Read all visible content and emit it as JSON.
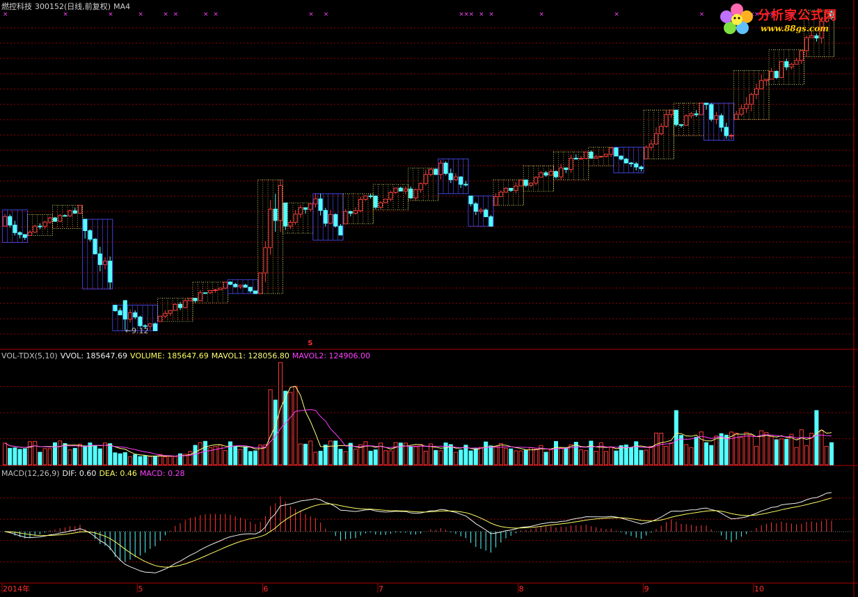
{
  "header": {
    "name": "燃控科技",
    "code": "300152",
    "period": "(日线,前复权)",
    "indicator": "MA4"
  },
  "logo": {
    "name": "分析家公式网",
    "url": "www.88gs.com"
  },
  "vol_header": {
    "title": "VOL-TDX(5,10)",
    "vvol": "VVOL: 185647.69",
    "volume": "VOLUME: 185647.69",
    "mavol1": "MAVOL1: 128056.80",
    "mavol2": "MAVOL2: 124906.00"
  },
  "macd_header": {
    "title": "MACD(12,26,9)",
    "dif": "DIF: 0.60",
    "dea": "DEA: 0.46",
    "macd": "MACD: 0.28"
  },
  "low_label": "9.12",
  "s_mark": "S",
  "x_labels": [
    {
      "text": "2014年",
      "index": 0
    },
    {
      "text": "5",
      "index": 27
    },
    {
      "text": "6",
      "index": 52
    },
    {
      "text": "7",
      "index": 75
    },
    {
      "text": "8",
      "index": 103
    },
    {
      "text": "9",
      "index": 128
    },
    {
      "text": "10",
      "index": 150
    }
  ],
  "colors": {
    "up": "#ff3a3a",
    "down": "#54ffff",
    "ma5": "#ffff80",
    "ma10": "#ff40ff",
    "dif": "#f0f0f0",
    "dea": "#ffff60",
    "grid": "#990000",
    "border": "#b00000",
    "box_up": "#ffff80",
    "box_down": "#5050ff",
    "marker": "#ff40ff"
  },
  "chart_data": {
    "type": "candlestick",
    "price_range": [
      9.0,
      20.0
    ],
    "boxes": [
      {
        "start": 0,
        "end": 4,
        "low": 12.9,
        "high": 14.3,
        "dir": "down"
      },
      {
        "start": 5,
        "end": 9,
        "low": 13.2,
        "high": 14.1,
        "dir": "up"
      },
      {
        "start": 10,
        "end": 15,
        "low": 13.5,
        "high": 14.5,
        "dir": "up"
      },
      {
        "start": 16,
        "end": 21,
        "low": 10.9,
        "high": 13.9,
        "dir": "down"
      },
      {
        "start": 22,
        "end": 30,
        "low": 9.1,
        "high": 10.2,
        "dir": "down"
      },
      {
        "start": 31,
        "end": 37,
        "low": 9.5,
        "high": 10.5,
        "dir": "up"
      },
      {
        "start": 38,
        "end": 44,
        "low": 10.3,
        "high": 11.2,
        "dir": "up"
      },
      {
        "start": 45,
        "end": 50,
        "low": 10.7,
        "high": 11.3,
        "dir": "down"
      },
      {
        "start": 51,
        "end": 55,
        "low": 10.7,
        "high": 15.6,
        "dir": "up"
      },
      {
        "start": 56,
        "end": 61,
        "low": 13.3,
        "high": 14.6,
        "dir": "up"
      },
      {
        "start": 62,
        "end": 67,
        "low": 13.0,
        "high": 15.0,
        "dir": "down"
      },
      {
        "start": 68,
        "end": 73,
        "low": 13.7,
        "high": 15.0,
        "dir": "up"
      },
      {
        "start": 74,
        "end": 80,
        "low": 14.3,
        "high": 15.4,
        "dir": "up"
      },
      {
        "start": 81,
        "end": 86,
        "low": 14.7,
        "high": 16.1,
        "dir": "up"
      },
      {
        "start": 87,
        "end": 92,
        "low": 15.0,
        "high": 16.5,
        "dir": "down"
      },
      {
        "start": 93,
        "end": 97,
        "low": 13.6,
        "high": 14.9,
        "dir": "down"
      },
      {
        "start": 98,
        "end": 103,
        "low": 14.5,
        "high": 15.6,
        "dir": "up"
      },
      {
        "start": 104,
        "end": 109,
        "low": 15.1,
        "high": 16.2,
        "dir": "up"
      },
      {
        "start": 110,
        "end": 116,
        "low": 15.6,
        "high": 16.8,
        "dir": "up"
      },
      {
        "start": 117,
        "end": 121,
        "low": 16.2,
        "high": 17.0,
        "dir": "up"
      },
      {
        "start": 122,
        "end": 127,
        "low": 15.9,
        "high": 17.0,
        "dir": "down"
      },
      {
        "start": 128,
        "end": 133,
        "low": 16.5,
        "high": 18.6,
        "dir": "up"
      },
      {
        "start": 134,
        "end": 139,
        "low": 17.5,
        "high": 18.9,
        "dir": "up"
      },
      {
        "start": 140,
        "end": 145,
        "low": 17.3,
        "high": 18.9,
        "dir": "down"
      },
      {
        "start": 146,
        "end": 152,
        "low": 18.2,
        "high": 20.3,
        "dir": "up"
      },
      {
        "start": 153,
        "end": 159,
        "low": 19.7,
        "high": 21.2,
        "dir": "up"
      },
      {
        "start": 160,
        "end": 165,
        "low": 20.9,
        "high": 22.9,
        "dir": "up"
      }
    ],
    "price_scale": {
      "top": 22.8,
      "bottom": 8.9
    },
    "low_point": {
      "index": 24,
      "value": 9.12
    },
    "volume_scale": [
      0,
      1000000
    ],
    "macd_scale": [
      -1.5,
      1.6
    ],
    "markers": [
      0,
      12,
      21,
      27,
      32,
      34,
      40,
      42,
      61,
      64,
      91,
      92,
      93,
      95,
      97,
      107,
      122,
      139,
      145,
      146,
      149,
      150,
      152,
      153,
      157
    ]
  }
}
